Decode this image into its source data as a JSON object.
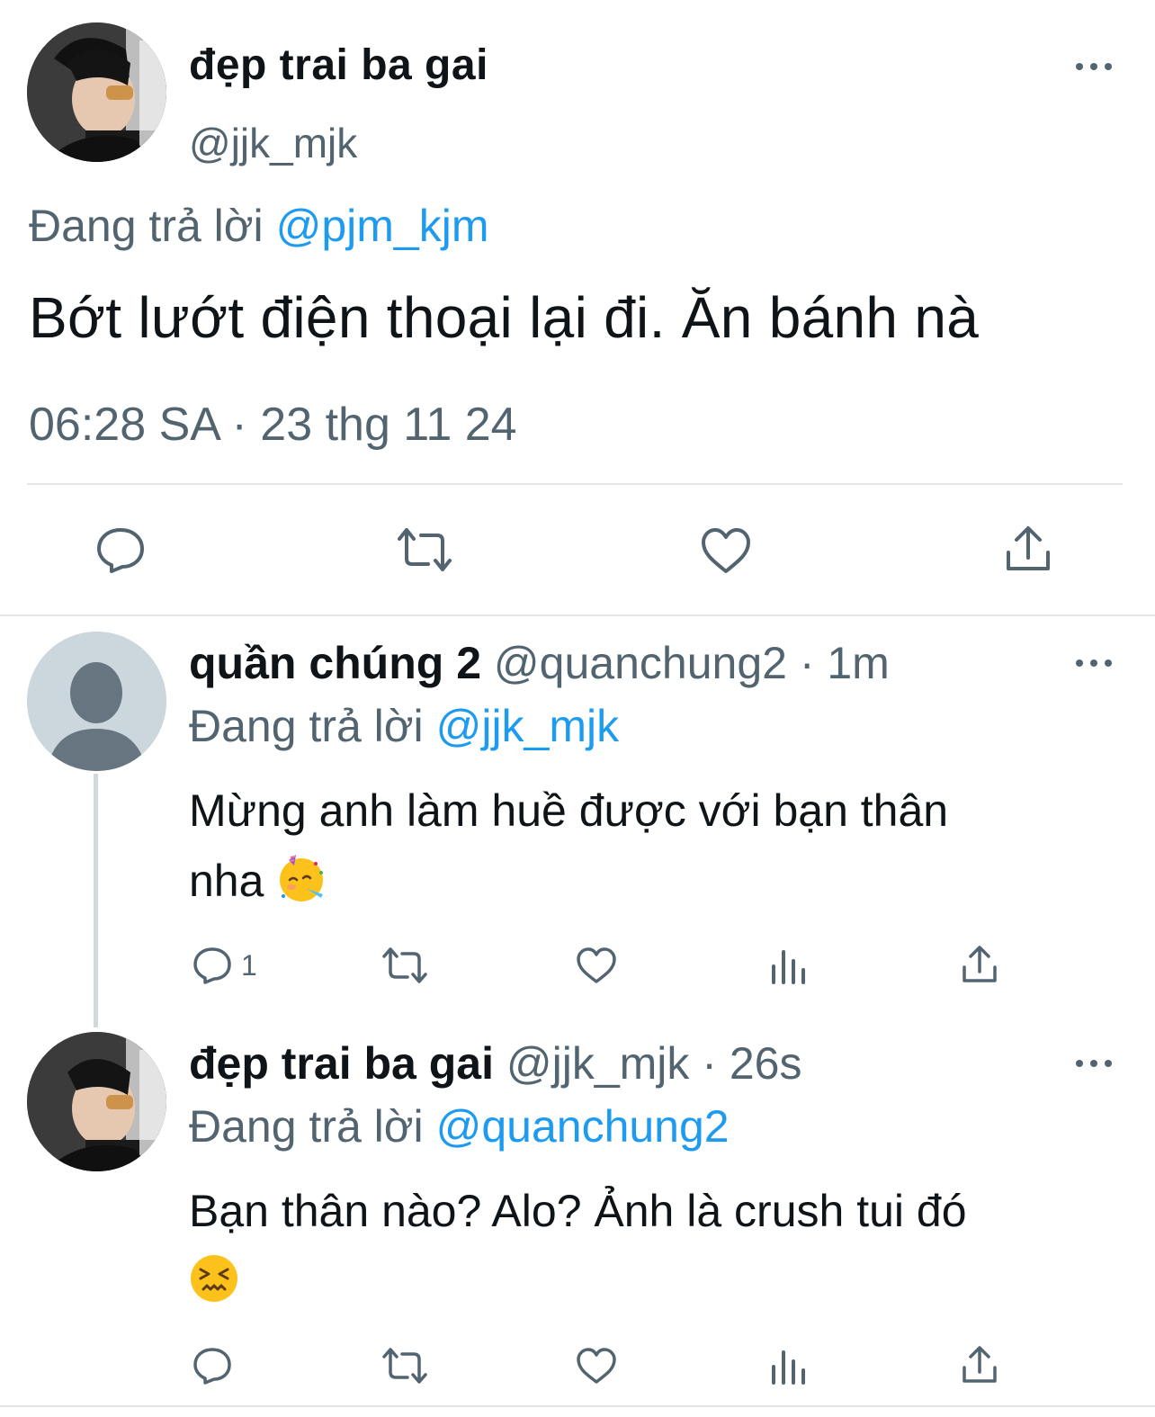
{
  "main_tweet": {
    "display_name": "đẹp trai ba gai",
    "handle": "@jjk_mjk",
    "reply_prefix": "Đang trả lời",
    "reply_to": "@pjm_kjm",
    "text": "Bớt lướt điện thoại lại đi. Ăn bánh nà",
    "timestamp": "06:28 SA · 23 thg 11 24",
    "actions": [
      "reply-icon",
      "retweet-icon",
      "like-icon",
      "share-icon"
    ]
  },
  "replies": [
    {
      "display_name": "quần chúng 2",
      "handle_time": "@quanchung2 · 1m",
      "reply_prefix": "Đang trả lời",
      "reply_to": "@jjk_mjk",
      "text_line1": "Mừng anh làm huề được với bạn thân",
      "text_line2": "nha",
      "emoji": "partying-face-emoji",
      "reply_count": "1",
      "actions": [
        "reply-icon",
        "retweet-icon",
        "like-icon",
        "views-icon",
        "share-icon"
      ]
    },
    {
      "display_name": "đẹp trai ba gai",
      "handle_time": "@jjk_mjk · 26s",
      "reply_prefix": "Đang trả lời",
      "reply_to": "@quanchung2",
      "text_line1": "Bạn thân nào? Alo? Ảnh là crush tui đó",
      "emoji": "confounded-face-emoji",
      "actions": [
        "reply-icon",
        "retweet-icon",
        "like-icon",
        "views-icon",
        "share-icon"
      ]
    }
  ],
  "colors": {
    "text": "#0f1419",
    "secondary": "#536471",
    "accent": "#1d9bf0",
    "divider": "#e6e6e6",
    "thread_line": "#cfd9de"
  }
}
